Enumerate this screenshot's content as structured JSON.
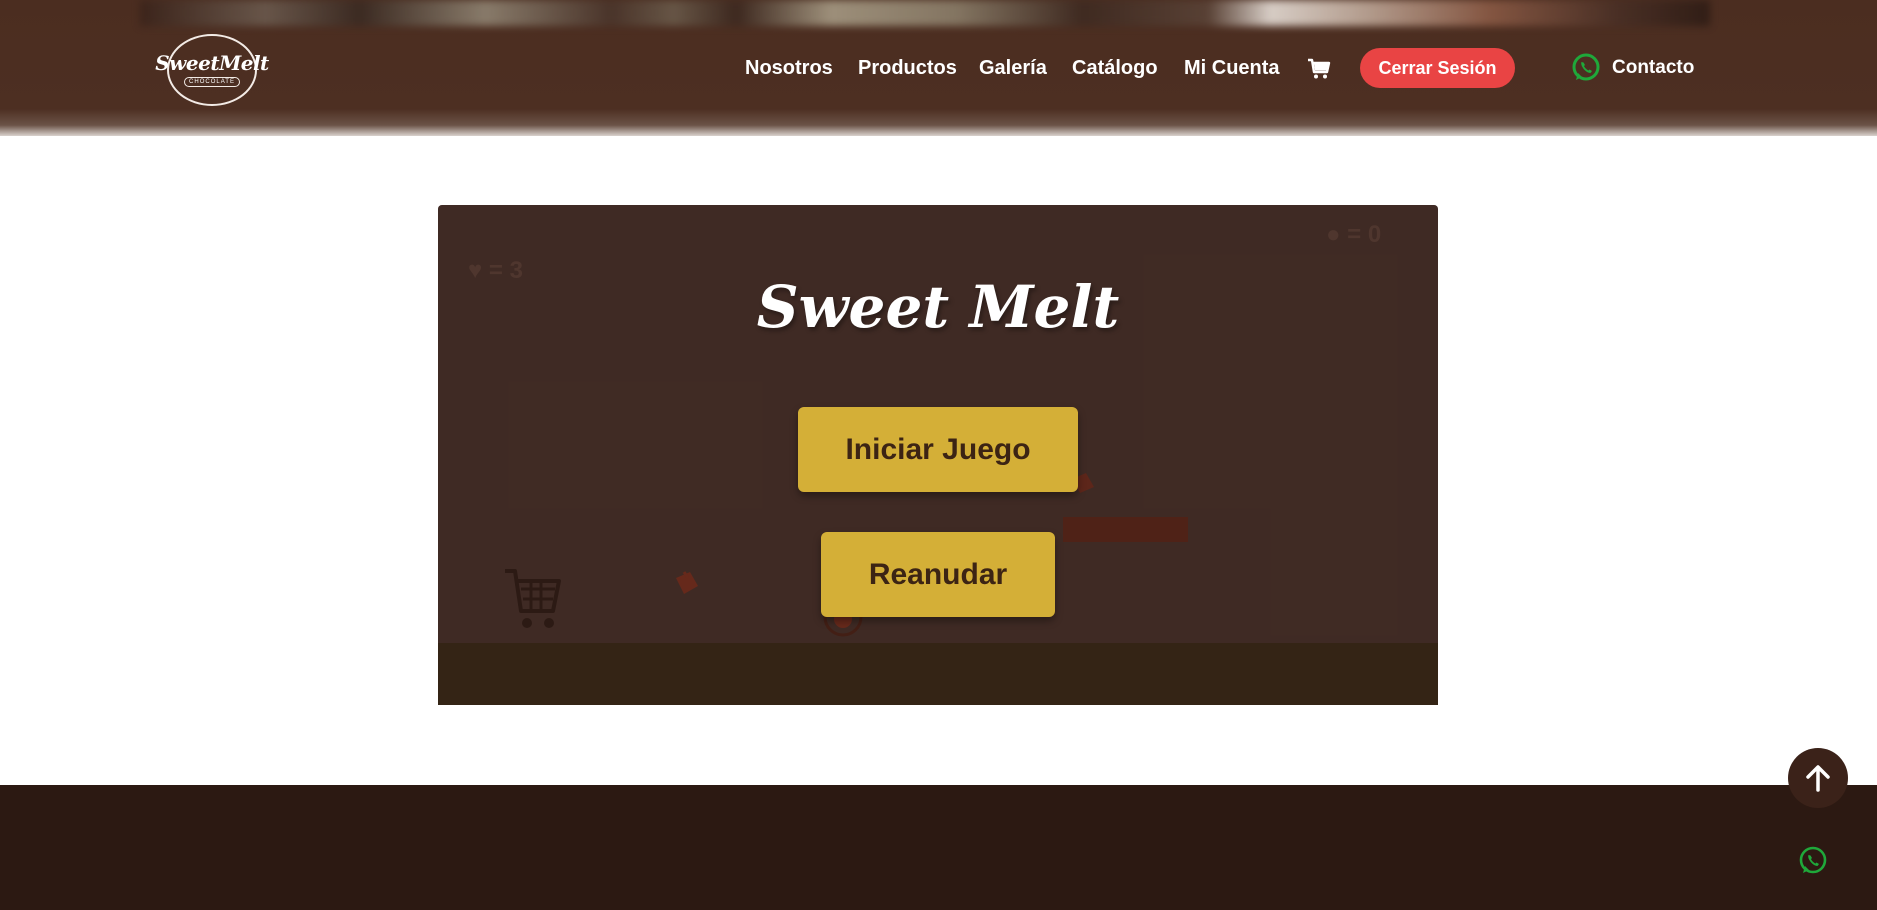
{
  "header": {
    "logo": {
      "brand": "SweetMelt",
      "tagline": "CHOCOLATE"
    },
    "nav": [
      {
        "label": "Nosotros"
      },
      {
        "label": "Productos"
      },
      {
        "label": "Galería"
      },
      {
        "label": "Catálogo"
      },
      {
        "label": "Mi Cuenta"
      }
    ],
    "cart_icon": "shopping-cart-icon",
    "logout_label": "Cerrar Sesión",
    "contact_label": "Contacto",
    "contact_icon": "whatsapp-icon"
  },
  "game": {
    "title": "Sweet Melt",
    "lives_label": "♥ = 3",
    "score_label": "● = 0",
    "start_label": "Iniciar Juego",
    "resume_label": "Reanudar"
  },
  "floating": {
    "scroll_top_icon": "arrow-up-icon",
    "whatsapp_icon": "whatsapp-icon"
  },
  "colors": {
    "header_bg": "#4b2d20",
    "logout_bg": "#e94444",
    "game_bg": "#45302a",
    "game_button": "#d4af37",
    "footer_bg": "#2c1912",
    "whatsapp": "#25a244"
  }
}
